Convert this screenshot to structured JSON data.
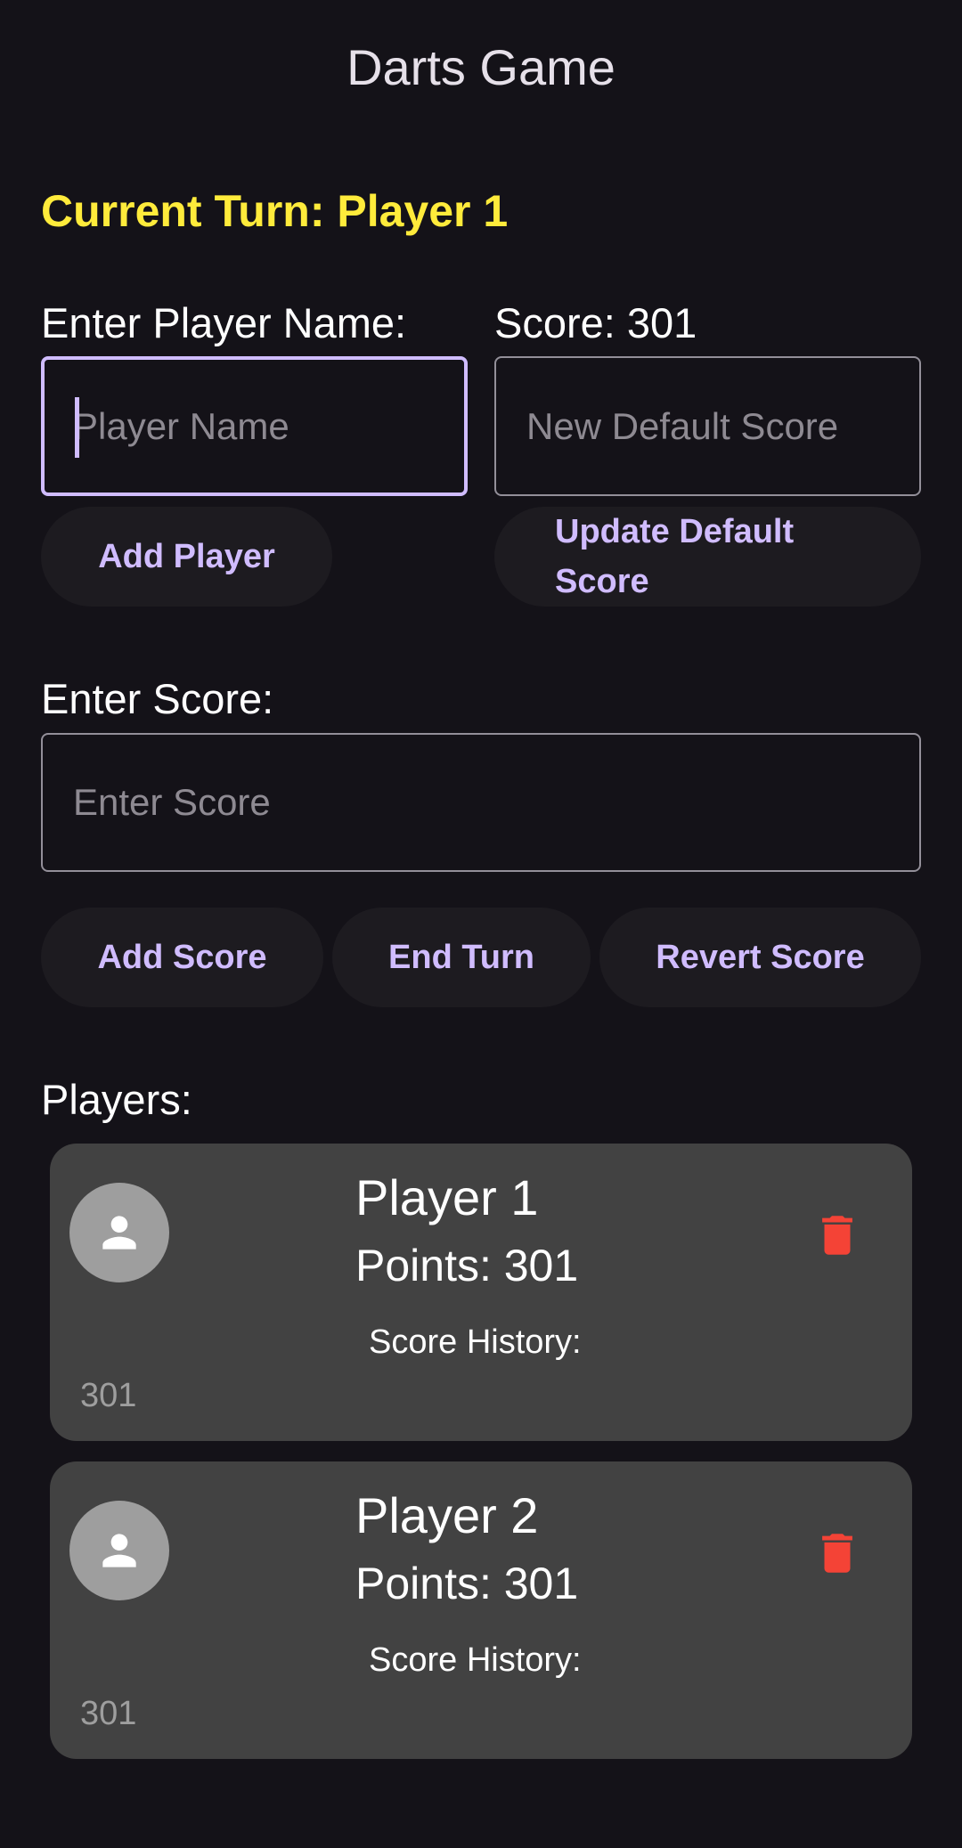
{
  "app": {
    "title": "Darts Game"
  },
  "turn": {
    "text": "Current Turn: Player 1"
  },
  "player_name": {
    "label": "Enter Player Name:",
    "placeholder": "Player Name",
    "value": ""
  },
  "default_score": {
    "label": "Score: 301",
    "placeholder": "New Default Score",
    "value": ""
  },
  "buttons": {
    "add_player": "Add Player",
    "update_default_score": "Update Default Score",
    "add_score": "Add Score",
    "end_turn": "End Turn",
    "revert_score": "Revert Score"
  },
  "score_entry": {
    "label": "Enter Score:",
    "placeholder": "Enter Score",
    "value": ""
  },
  "players_section": {
    "label": "Players:",
    "history_label": "Score History:",
    "players": [
      {
        "name": "Player 1",
        "points": "Points: 301",
        "history": "301"
      },
      {
        "name": "Player 2",
        "points": "Points: 301",
        "history": "301"
      }
    ]
  },
  "colors": {
    "background": "#141218",
    "accent": "#D0BCFF",
    "turn_highlight": "#FFEB3B",
    "card": "#424242",
    "delete": "#F44336",
    "avatar": "#9E9E9E"
  },
  "icons": {
    "avatar": "person-icon",
    "delete": "trash-icon"
  }
}
